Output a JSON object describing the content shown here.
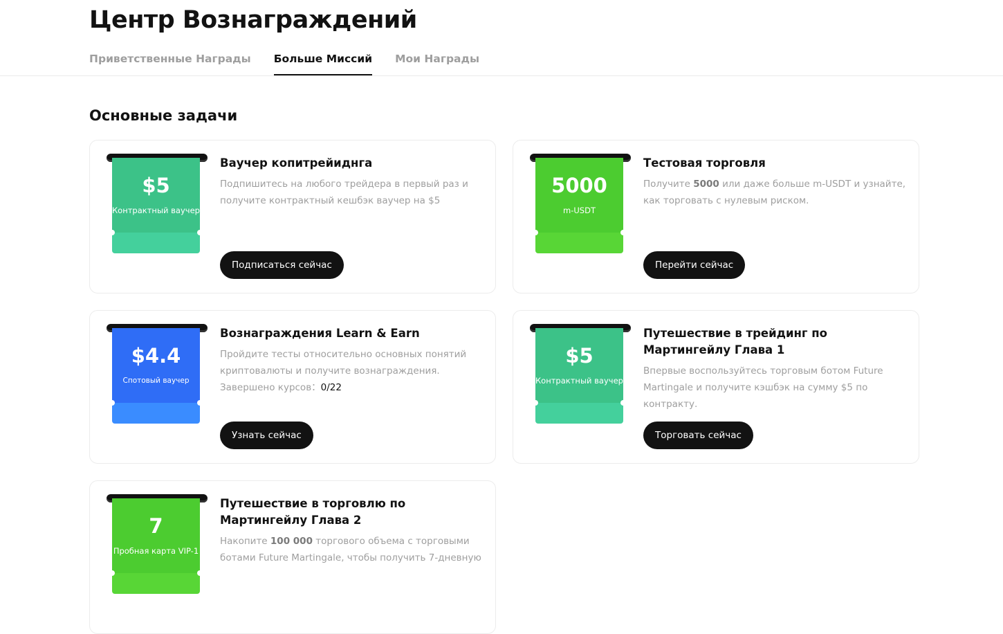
{
  "page": {
    "title": "Центр Вознаграждений",
    "tabs": [
      {
        "label": "Приветственные Награды",
        "active": false
      },
      {
        "label": "Больше Миссий",
        "active": true
      },
      {
        "label": "Мои Награды",
        "active": false
      }
    ],
    "section_title": "Основные задачи"
  },
  "cards": [
    {
      "ticket": {
        "amount": "$5",
        "unit": "Контрактный ваучер",
        "color": "#3cc288"
      },
      "title": "Ваучер копитрейиднга",
      "desc": "Подпишитесь на любого трейдера в первый раз и получите контрактный кешбэк ваучер на $5",
      "button": "Подписаться сейчас"
    },
    {
      "ticket": {
        "amount": "5000",
        "unit": "m-USDT",
        "color": "#4ccc30"
      },
      "title": "Тестовая торговля",
      "desc_before": "Получите ",
      "desc_bold": "5000",
      "desc_after": " или даже больше m-USDT и узнайте, как торговать с нулевым риском.",
      "button": "Перейти сейчас"
    },
    {
      "ticket": {
        "amount": "$4.4",
        "unit": "Спотовый ваучер",
        "color": "#2f6df6"
      },
      "title": "Вознаграждения Learn & Earn",
      "desc": "Пройдите тесты относительно основных понятий криптовалюты и получите вознаграждения.",
      "progress_label": "Завершено курсов：",
      "progress_done": "0",
      "progress_total": "/22",
      "button": "Узнать сейчас"
    },
    {
      "ticket": {
        "amount": "$5",
        "unit": "Контрактный ваучер",
        "color": "#3cc288"
      },
      "title": "Путешествие в трейдинг по Мартингейлу Глава 1",
      "desc": "Впервые воспользуйтесь торговым ботом Future Martingale и получите кэшбэк на сумму $5 по контракту.",
      "button": "Торговать сейчас"
    },
    {
      "ticket": {
        "amount": "7",
        "unit": "Пробная карта VIP-1",
        "color": "#4ccc30"
      },
      "title": "Путешествие в торговлю по Мартингейлу Глава 2",
      "desc_before": "Накопите ",
      "desc_bold": "100 000",
      "desc_after": " торгового объема с торговыми ботами Future Martingale, чтобы получить 7-дневную"
    }
  ]
}
